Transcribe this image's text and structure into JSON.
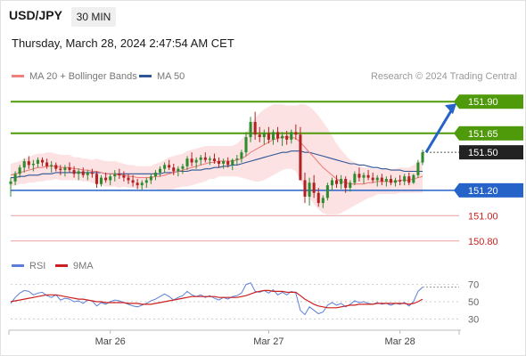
{
  "header": {
    "symbol": "USD/JPY",
    "timeframe": "30 MIN",
    "datetime": "Thursday, March 28, 2024 2:47:54 AM CET"
  },
  "legend": {
    "ma20_label": "MA 20 + Bollinger Bands",
    "ma50_label": "MA 50",
    "credit": "Research © 2024 Trading Central"
  },
  "rsi_legend": {
    "rsi_label": "RSI",
    "ma9_label": "9MA"
  },
  "colors": {
    "ma20": "#f08080",
    "ma50": "#2f5597",
    "bull": "#2e8b2e",
    "bear": "#b22222",
    "resistance": "#4f9a0a",
    "support": "#2563c9",
    "target": "#cc1f1f",
    "current": "#222222",
    "bands": "#fbd8d8",
    "rsi": "#5b7fd6",
    "rsi_ma": "#cc1f1f"
  },
  "chart_data": [
    {
      "type": "candlestick",
      "title": "USD/JPY",
      "timeframe": "30 MIN",
      "x_ticks": [
        "Mar 26",
        "Mar 27",
        "Mar 28"
      ],
      "ylim": [
        150.7,
        152.0
      ],
      "levels": [
        {
          "value": 151.9,
          "label": "151.90",
          "kind": "resistance"
        },
        {
          "value": 151.65,
          "label": "151.65",
          "kind": "resistance"
        },
        {
          "value": 151.5,
          "label": "151.50",
          "kind": "current"
        },
        {
          "value": 151.2,
          "label": "151.20",
          "kind": "support"
        },
        {
          "value": 151.0,
          "label": "151.00",
          "kind": "target"
        },
        {
          "value": 150.8,
          "label": "150.80",
          "kind": "target"
        }
      ],
      "projection": {
        "from": 151.5,
        "to": 151.9,
        "direction": "up"
      },
      "candles": [
        [
          151.25,
          151.3,
          151.15,
          151.27
        ],
        [
          151.27,
          151.35,
          151.24,
          151.33
        ],
        [
          151.33,
          151.4,
          151.3,
          151.38
        ],
        [
          151.38,
          151.45,
          151.34,
          151.43
        ],
        [
          151.43,
          151.47,
          151.37,
          151.4
        ],
        [
          151.4,
          151.44,
          151.35,
          151.41
        ],
        [
          151.41,
          151.46,
          151.38,
          151.44
        ],
        [
          151.44,
          151.46,
          151.39,
          151.42
        ],
        [
          151.42,
          151.45,
          151.37,
          151.39
        ],
        [
          151.39,
          151.43,
          151.34,
          151.4
        ],
        [
          151.4,
          151.42,
          151.35,
          151.37
        ],
        [
          151.37,
          151.4,
          151.32,
          151.36
        ],
        [
          151.36,
          151.4,
          151.31,
          151.38
        ],
        [
          151.38,
          151.42,
          151.34,
          151.36
        ],
        [
          151.36,
          151.39,
          151.3,
          151.33
        ],
        [
          151.33,
          151.37,
          151.28,
          151.35
        ],
        [
          151.35,
          151.38,
          151.3,
          151.32
        ],
        [
          151.32,
          151.36,
          151.28,
          151.34
        ],
        [
          151.34,
          151.37,
          151.3,
          151.33
        ],
        [
          151.33,
          151.35,
          151.22,
          151.25
        ],
        [
          151.25,
          151.32,
          151.23,
          151.3
        ],
        [
          151.3,
          151.34,
          151.26,
          151.28
        ],
        [
          151.28,
          151.33,
          151.24,
          151.31
        ],
        [
          151.31,
          151.36,
          151.27,
          151.33
        ],
        [
          151.33,
          151.37,
          151.29,
          151.32
        ],
        [
          151.32,
          151.35,
          151.27,
          151.3
        ],
        [
          151.3,
          151.33,
          151.25,
          151.28
        ],
        [
          151.28,
          151.32,
          151.23,
          151.26
        ],
        [
          151.26,
          151.29,
          151.21,
          151.24
        ],
        [
          151.24,
          151.28,
          151.2,
          151.26
        ],
        [
          151.26,
          151.3,
          151.22,
          151.28
        ],
        [
          151.28,
          151.33,
          151.25,
          151.31
        ],
        [
          151.31,
          151.36,
          151.28,
          151.34
        ],
        [
          151.34,
          151.39,
          151.31,
          151.37
        ],
        [
          151.37,
          151.42,
          151.34,
          151.4
        ],
        [
          151.4,
          151.44,
          151.36,
          151.38
        ],
        [
          151.38,
          151.41,
          151.32,
          151.35
        ],
        [
          151.35,
          151.39,
          151.31,
          151.37
        ],
        [
          151.37,
          151.41,
          151.33,
          151.39
        ],
        [
          151.39,
          151.47,
          151.36,
          151.45
        ],
        [
          151.45,
          151.5,
          151.39,
          151.42
        ],
        [
          151.42,
          151.46,
          151.37,
          151.44
        ],
        [
          151.44,
          151.48,
          151.4,
          151.46
        ],
        [
          151.46,
          151.5,
          151.42,
          151.44
        ],
        [
          151.44,
          151.47,
          151.4,
          151.45
        ],
        [
          151.45,
          151.49,
          151.41,
          151.43
        ],
        [
          151.43,
          151.46,
          151.38,
          151.41
        ],
        [
          151.41,
          151.45,
          151.37,
          151.43
        ],
        [
          151.43,
          151.46,
          151.38,
          151.4
        ],
        [
          151.4,
          151.45,
          151.36,
          151.44
        ],
        [
          151.44,
          151.48,
          151.4,
          151.45
        ],
        [
          151.45,
          151.52,
          151.42,
          151.5
        ],
        [
          151.5,
          151.66,
          151.47,
          151.62
        ],
        [
          151.62,
          151.78,
          151.58,
          151.74
        ],
        [
          151.74,
          151.82,
          151.6,
          151.64
        ],
        [
          151.64,
          151.7,
          151.58,
          151.62
        ],
        [
          151.62,
          151.68,
          151.56,
          151.65
        ],
        [
          151.65,
          151.7,
          151.57,
          151.6
        ],
        [
          151.6,
          151.68,
          151.56,
          151.66
        ],
        [
          151.66,
          151.7,
          151.58,
          151.61
        ],
        [
          151.61,
          151.66,
          151.55,
          151.63
        ],
        [
          151.63,
          151.67,
          151.56,
          151.6
        ],
        [
          151.6,
          151.68,
          151.57,
          151.66
        ],
        [
          151.66,
          151.72,
          151.6,
          151.64
        ],
        [
          151.64,
          151.7,
          151.42,
          151.28
        ],
        [
          151.28,
          151.34,
          151.1,
          151.15
        ],
        [
          151.15,
          151.3,
          151.08,
          151.26
        ],
        [
          151.26,
          151.32,
          151.14,
          151.18
        ],
        [
          151.18,
          151.22,
          151.07,
          151.1
        ],
        [
          151.1,
          151.16,
          151.06,
          151.14
        ],
        [
          151.14,
          151.26,
          151.12,
          151.24
        ],
        [
          151.24,
          151.3,
          151.2,
          151.28
        ],
        [
          151.28,
          151.32,
          151.22,
          151.25
        ],
        [
          151.25,
          151.32,
          151.21,
          151.29
        ],
        [
          151.29,
          151.31,
          151.18,
          151.22
        ],
        [
          151.22,
          151.28,
          151.19,
          151.26
        ],
        [
          151.26,
          151.35,
          151.24,
          151.33
        ],
        [
          151.33,
          151.38,
          151.27,
          151.3
        ],
        [
          151.3,
          151.34,
          151.25,
          151.32
        ],
        [
          151.32,
          151.36,
          151.28,
          151.3
        ],
        [
          151.3,
          151.34,
          151.26,
          151.28
        ],
        [
          151.28,
          151.32,
          151.23,
          151.3
        ],
        [
          151.3,
          151.33,
          151.24,
          151.27
        ],
        [
          151.27,
          151.31,
          151.23,
          151.29
        ],
        [
          151.29,
          151.32,
          151.24,
          151.26
        ],
        [
          151.26,
          151.3,
          151.23,
          151.28
        ],
        [
          151.28,
          151.32,
          151.24,
          151.27
        ],
        [
          151.27,
          151.33,
          151.24,
          151.31
        ],
        [
          151.31,
          151.34,
          151.24,
          151.26
        ],
        [
          151.26,
          151.33,
          151.25,
          151.32
        ],
        [
          151.32,
          151.44,
          151.3,
          151.42
        ],
        [
          151.42,
          151.52,
          151.4,
          151.5
        ]
      ],
      "ma20": [
        151.32,
        151.33,
        151.34,
        151.35,
        151.36,
        151.37,
        151.38,
        151.38,
        151.39,
        151.39,
        151.39,
        151.38,
        151.38,
        151.38,
        151.37,
        151.37,
        151.36,
        151.36,
        151.35,
        151.35,
        151.34,
        151.33,
        151.33,
        151.33,
        151.32,
        151.32,
        151.31,
        151.31,
        151.3,
        151.3,
        151.3,
        151.3,
        151.31,
        151.31,
        151.32,
        151.33,
        151.34,
        151.35,
        151.36,
        151.37,
        151.38,
        151.39,
        151.4,
        151.41,
        151.42,
        151.42,
        151.43,
        151.43,
        151.43,
        151.43,
        151.44,
        151.45,
        151.47,
        151.5,
        151.52,
        151.54,
        151.56,
        151.58,
        151.6,
        151.61,
        151.62,
        151.62,
        151.62,
        151.61,
        151.58,
        151.54,
        151.5,
        151.46,
        151.42,
        151.38,
        151.35,
        151.32,
        151.29,
        151.27,
        151.26,
        151.25,
        151.25,
        151.25,
        151.25,
        151.26,
        151.26,
        151.27,
        151.27,
        151.27,
        151.27,
        151.27,
        151.28,
        151.28,
        151.28,
        151.29,
        151.3,
        151.31
      ],
      "ma50": [
        151.3,
        151.3,
        151.31,
        151.31,
        151.32,
        151.32,
        151.32,
        151.33,
        151.33,
        151.33,
        151.34,
        151.34,
        151.34,
        151.34,
        151.34,
        151.34,
        151.34,
        151.34,
        151.34,
        151.34,
        151.34,
        151.33,
        151.33,
        151.33,
        151.33,
        151.33,
        151.33,
        151.33,
        151.33,
        151.33,
        151.33,
        151.33,
        151.33,
        151.33,
        151.34,
        151.34,
        151.34,
        151.35,
        151.35,
        151.35,
        151.36,
        151.36,
        151.36,
        151.37,
        151.37,
        151.38,
        151.38,
        151.39,
        151.39,
        151.4,
        151.4,
        151.41,
        151.42,
        151.43,
        151.44,
        151.45,
        151.46,
        151.47,
        151.48,
        151.49,
        151.5,
        151.5,
        151.51,
        151.51,
        151.51,
        151.5,
        151.5,
        151.49,
        151.48,
        151.47,
        151.46,
        151.45,
        151.44,
        151.43,
        151.42,
        151.41,
        151.41,
        151.4,
        151.4,
        151.39,
        151.38,
        151.38,
        151.37,
        151.37,
        151.36,
        151.36,
        151.36,
        151.35,
        151.35,
        151.35,
        151.35,
        151.35
      ],
      "band_width": [
        0.09,
        0.09,
        0.09,
        0.1,
        0.1,
        0.11,
        0.11,
        0.11,
        0.11,
        0.11,
        0.1,
        0.1,
        0.1,
        0.1,
        0.09,
        0.09,
        0.09,
        0.09,
        0.09,
        0.1,
        0.1,
        0.1,
        0.1,
        0.1,
        0.1,
        0.09,
        0.09,
        0.09,
        0.09,
        0.09,
        0.09,
        0.09,
        0.1,
        0.11,
        0.12,
        0.13,
        0.13,
        0.13,
        0.13,
        0.14,
        0.14,
        0.14,
        0.14,
        0.14,
        0.13,
        0.13,
        0.12,
        0.12,
        0.12,
        0.12,
        0.13,
        0.15,
        0.18,
        0.22,
        0.25,
        0.27,
        0.28,
        0.28,
        0.28,
        0.27,
        0.26,
        0.25,
        0.25,
        0.26,
        0.3,
        0.34,
        0.36,
        0.37,
        0.37,
        0.36,
        0.34,
        0.31,
        0.28,
        0.25,
        0.22,
        0.19,
        0.17,
        0.15,
        0.13,
        0.12,
        0.11,
        0.1,
        0.1,
        0.1,
        0.1,
        0.1,
        0.1,
        0.1,
        0.1,
        0.11,
        0.12,
        0.13
      ]
    },
    {
      "type": "line",
      "title": "RSI",
      "y_ticks": [
        70,
        50,
        30
      ],
      "ylim": [
        20,
        80
      ],
      "series": [
        {
          "name": "RSI",
          "values": [
            48,
            55,
            60,
            63,
            62,
            58,
            60,
            61,
            57,
            55,
            58,
            52,
            54,
            53,
            50,
            51,
            48,
            52,
            51,
            45,
            49,
            47,
            50,
            52,
            51,
            49,
            47,
            45,
            44,
            46,
            48,
            51,
            53,
            56,
            59,
            56,
            52,
            55,
            57,
            62,
            58,
            56,
            58,
            55,
            57,
            54,
            52,
            55,
            53,
            56,
            57,
            60,
            70,
            72,
            62,
            61,
            63,
            60,
            64,
            58,
            61,
            58,
            62,
            60,
            40,
            35,
            44,
            40,
            36,
            38,
            46,
            49,
            46,
            48,
            44,
            47,
            51,
            49,
            50,
            48,
            47,
            49,
            47,
            48,
            46,
            48,
            47,
            49,
            45,
            50,
            62,
            67
          ]
        },
        {
          "name": "9MA",
          "values": [
            50,
            51,
            52,
            53,
            54,
            55,
            56,
            57,
            58,
            58,
            58,
            57,
            56,
            55,
            54,
            53,
            53,
            52,
            51,
            50,
            50,
            49,
            49,
            49,
            49,
            49,
            48,
            48,
            48,
            47,
            47,
            47,
            48,
            49,
            50,
            51,
            52,
            53,
            54,
            55,
            56,
            56,
            56,
            56,
            56,
            56,
            55,
            55,
            55,
            55,
            55,
            56,
            57,
            59,
            61,
            62,
            63,
            63,
            62,
            62,
            62,
            61,
            61,
            61,
            57,
            53,
            50,
            47,
            45,
            44,
            43,
            43,
            43,
            44,
            45,
            46,
            46,
            47,
            47,
            47,
            47,
            48,
            48,
            48,
            48,
            48,
            48,
            48,
            47,
            48,
            50,
            53
          ]
        }
      ]
    }
  ]
}
